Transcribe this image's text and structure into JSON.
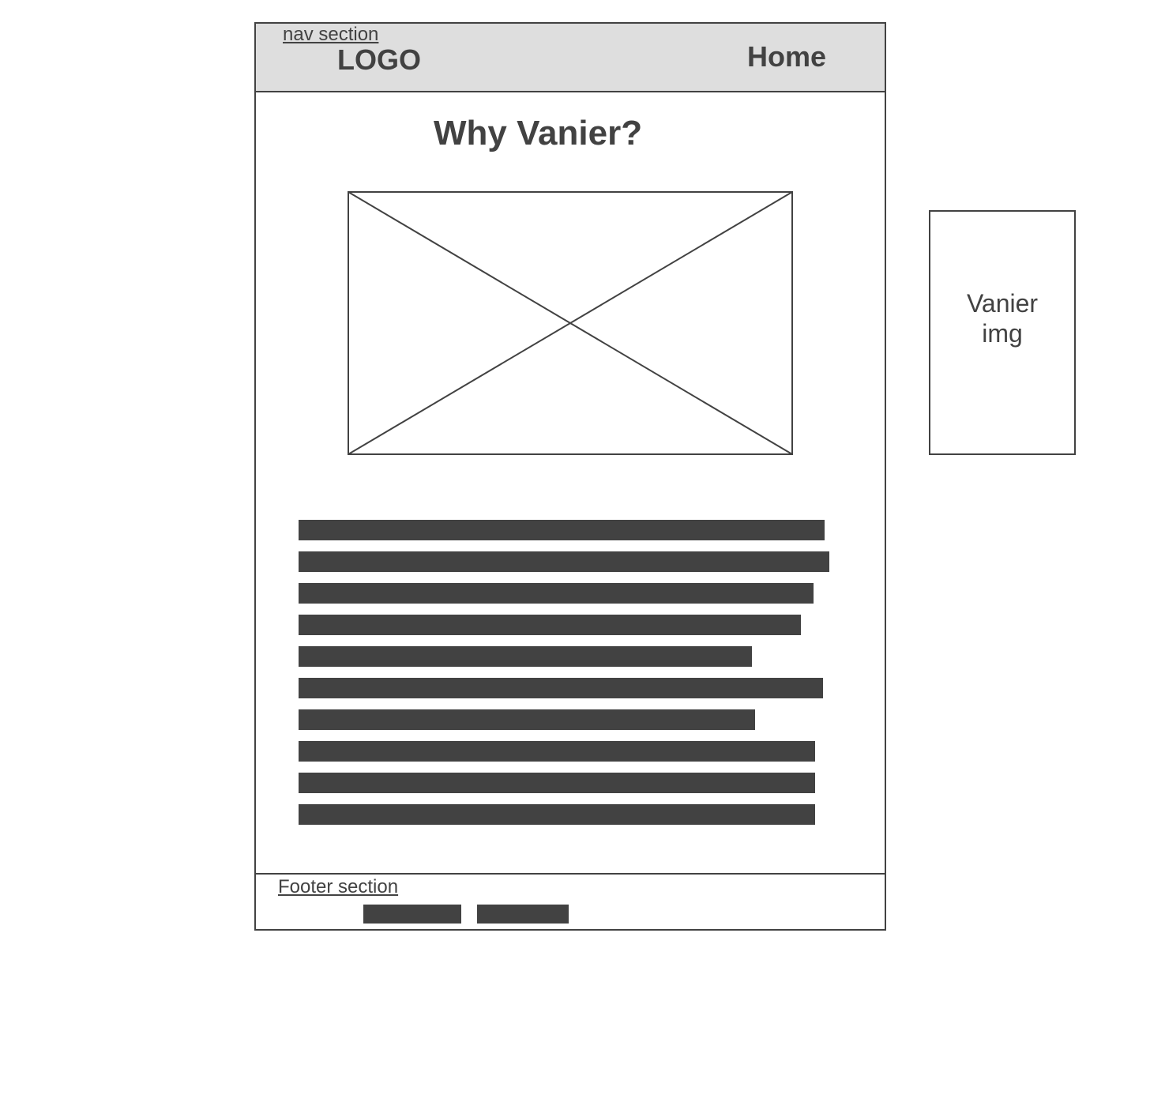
{
  "nav": {
    "caption": "nav section",
    "logo": "LOGO",
    "home": "Home"
  },
  "main": {
    "title": "Why Vanier?",
    "text_line_widths_pct": [
      99.1,
      100,
      97.0,
      94.6,
      85.4,
      98.8,
      86.0,
      97.3,
      97.3,
      97.3
    ]
  },
  "footer": {
    "caption": "Footer section"
  },
  "side_note": {
    "label": "Vanier img"
  },
  "colors": {
    "ink": "#424242",
    "nav_bg": "#dedede",
    "page_bg": "#ffffff"
  }
}
